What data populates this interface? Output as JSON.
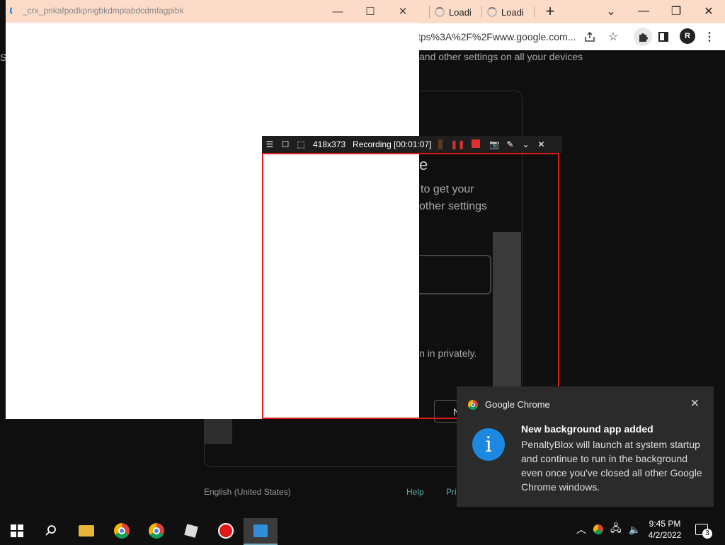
{
  "browser": {
    "tabs": [
      {
        "label": "Loadi"
      },
      {
        "label": "Loadi"
      }
    ],
    "new_tab": "+",
    "tab_search": "⌄",
    "minimize": "—",
    "maximize": "❐",
    "close": "✕",
    "url_visible": "tps%3A%2F%2Fwww.google.com...",
    "profile_initial": "R"
  },
  "page": {
    "sync_text": "and other settings on all your devices",
    "heading_fragment": "e",
    "line1": "to get your",
    "line2": "other settings",
    "privately": "n in privately.",
    "next_fragment": "N",
    "language": "English (United States)",
    "help": "Help",
    "privacy_fragment": "Pri",
    "left_char": "S"
  },
  "popup": {
    "title": "_crx_pnkafpodkpnigbkdmplabdcdmfagpibk",
    "minimize": "—",
    "maximize": "☐",
    "close": "✕"
  },
  "recorder": {
    "size": "418x373",
    "status": "Recording [00:01:07]"
  },
  "notification": {
    "app": "Google Chrome",
    "title": "New background app added",
    "body": "PenaltyBlox will launch at system startup and continue to run in the background even once you've closed all other Google Chrome windows.",
    "close": "✕"
  },
  "taskbar": {
    "time": "9:45 PM",
    "date": "4/2/2022",
    "notif_count": "3"
  },
  "colors": {
    "tab_strip": "#fcdcc8",
    "record_red": "#e01818",
    "info_blue": "#1d88e0",
    "taskbar": "#101010"
  }
}
